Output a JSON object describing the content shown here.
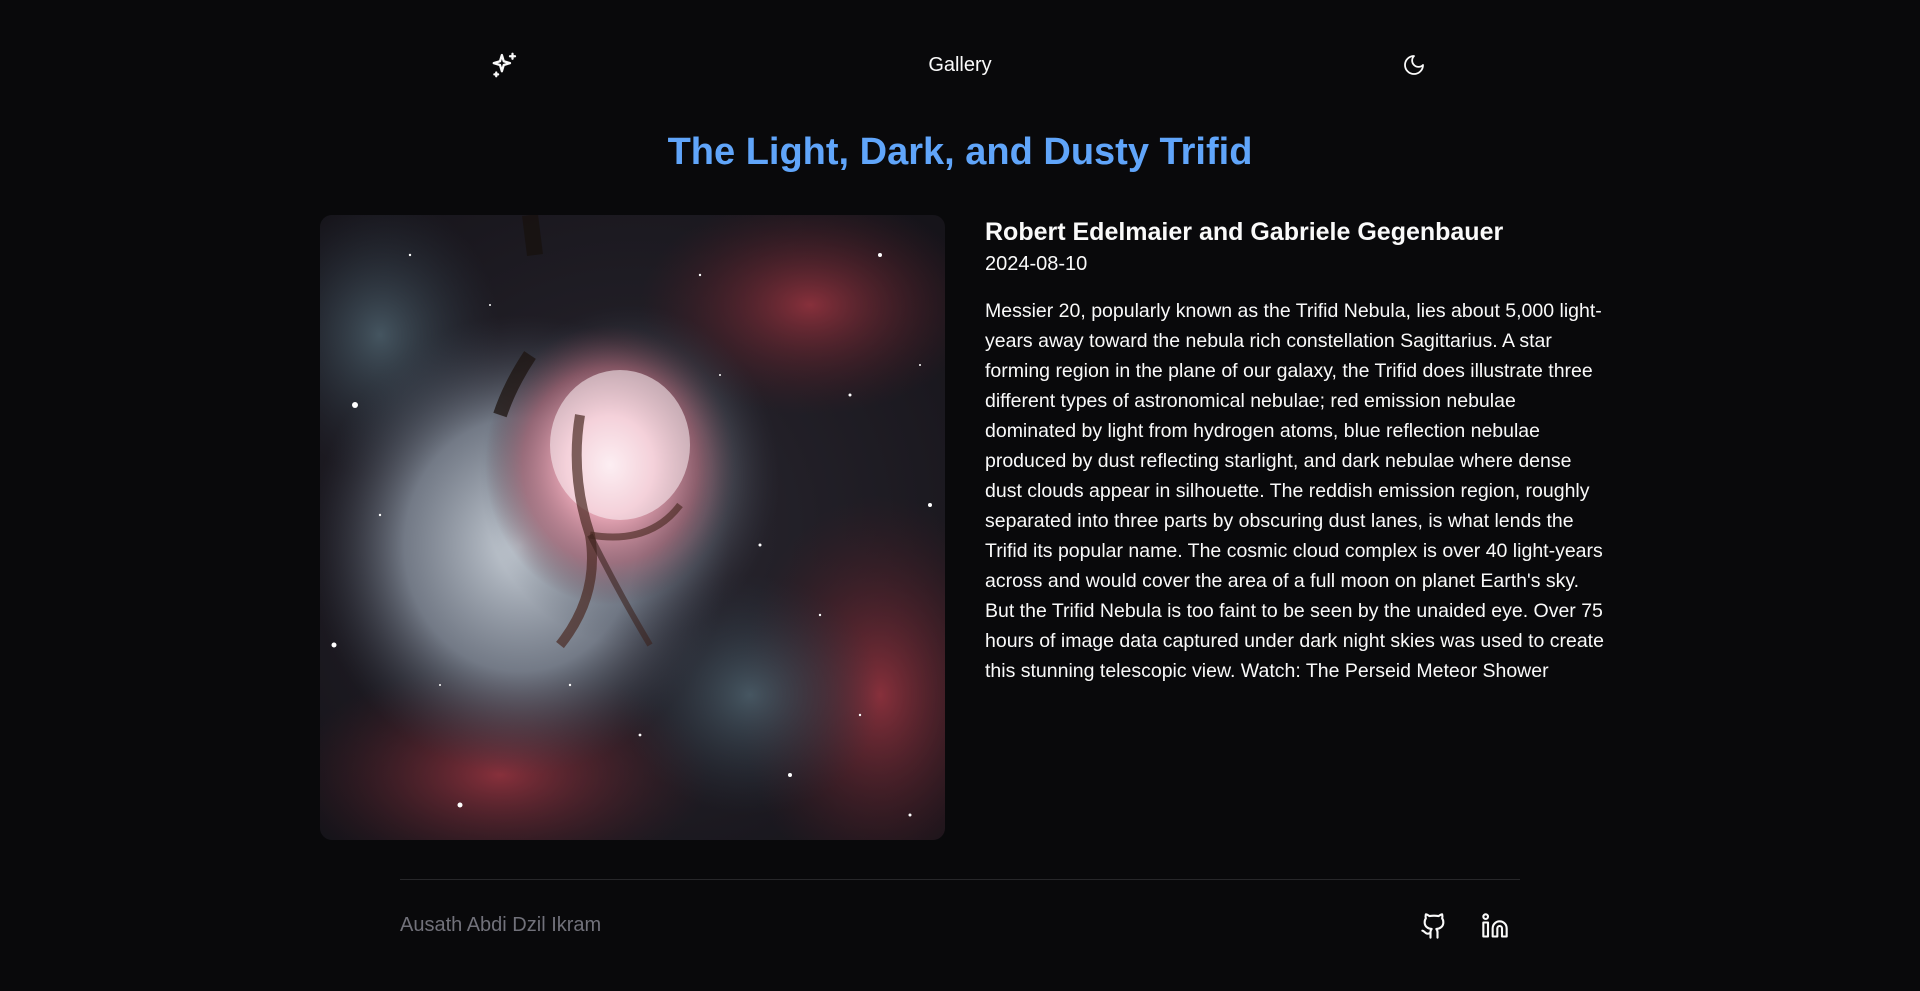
{
  "header": {
    "nav_label": "Gallery"
  },
  "page": {
    "title": "The Light, Dark, and Dusty Trifid"
  },
  "apod": {
    "author": "Robert Edelmaier and Gabriele Gegenbauer",
    "date": "2024-08-10",
    "description": "Messier 20, popularly known as the Trifid Nebula, lies about 5,000 light-years away toward the nebula rich constellation Sagittarius. A star forming region in the plane of our galaxy, the Trifid does illustrate three different types of astronomical nebulae; red emission nebulae dominated by light from hydrogen atoms, blue reflection nebulae produced by dust reflecting starlight, and dark nebulae where dense dust clouds appear in silhouette. The reddish emission region, roughly separated into three parts by obscuring dust lanes, is what lends the Trifid its popular name. The cosmic cloud complex is over 40 light-years across and would cover the area of a full moon on planet Earth's sky. But the Trifid Nebula is too faint to be seen by the unaided eye. Over 75 hours of image data captured under dark night skies was used to create this stunning telescopic view. Watch: The Perseid Meteor Shower"
  },
  "footer": {
    "author_name": "Ausath Abdi Dzil Ikram"
  },
  "icons": {
    "logo": "sparkles-icon",
    "theme": "moon-icon",
    "github": "github-icon",
    "linkedin": "linkedin-icon"
  },
  "colors": {
    "background": "#09090b",
    "title_accent": "#60a5fa",
    "text": "#fafafa",
    "muted": "#71717a"
  }
}
